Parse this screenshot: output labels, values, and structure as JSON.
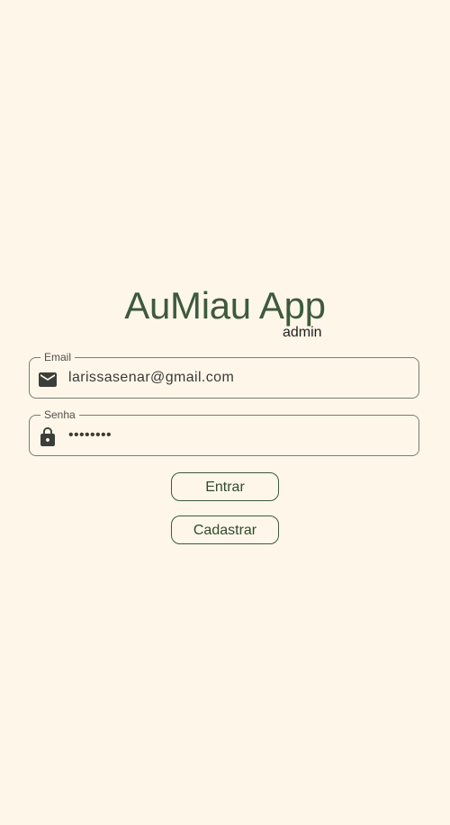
{
  "app": {
    "title": "AuMiau App",
    "subtitle": "admin"
  },
  "form": {
    "email": {
      "label": "Email",
      "value": "larissasenar@gmail.com",
      "icon": "mail-icon"
    },
    "senha": {
      "label": "Senha",
      "value": "••••••••",
      "icon": "lock-icon"
    },
    "entrar_label": "Entrar",
    "cadastrar_label": "Cadastrar"
  },
  "colors": {
    "background": "#fef6e9",
    "accent": "#3d5a3d",
    "border": "#7b7b72"
  }
}
